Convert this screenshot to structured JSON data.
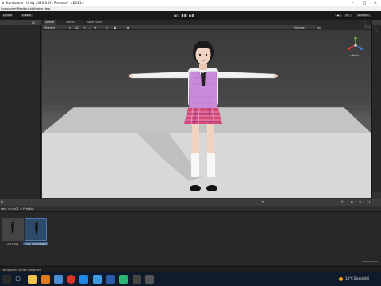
{
  "window": {
    "title": "w Standalone - Unity 2020.3.4f1 Personal* <DX11>",
    "controls": [
      "–",
      "□",
      "✕"
    ]
  },
  "menu": [
    "Component",
    "Realtouch",
    "Window",
    "Help"
  ],
  "toolbar": {
    "left_buttons": [
      "Center",
      "Global"
    ],
    "play": "▶",
    "pause": "❚❚",
    "step": "▶❚",
    "right_label": "Account"
  },
  "scene_tabs": [
    "Scene",
    "Game",
    "Asset Store"
  ],
  "scene_bar": {
    "shading": "Shaded",
    "mode2d": "2D",
    "gizmos": "Gizmos",
    "search": "All"
  },
  "gizmo": {
    "persp_label": "< Persp"
  },
  "project": {
    "toolbar_left": "ts",
    "path": "sets > chr01 > Prefabs",
    "count": "11",
    "assets": [
      {
        "label": "unity_50a"
      },
      {
        "label": "unity_50a_Rotated"
      }
    ]
  },
  "status": {
    "message": "component is not initialized"
  },
  "taskbar": {
    "weather": "14°C Ensoleillé"
  },
  "colors": {
    "sweater": "#c98ad9",
    "skirt": "#d54a7a",
    "hair": "#1a1a1a",
    "selection": "#3b5f8c"
  }
}
